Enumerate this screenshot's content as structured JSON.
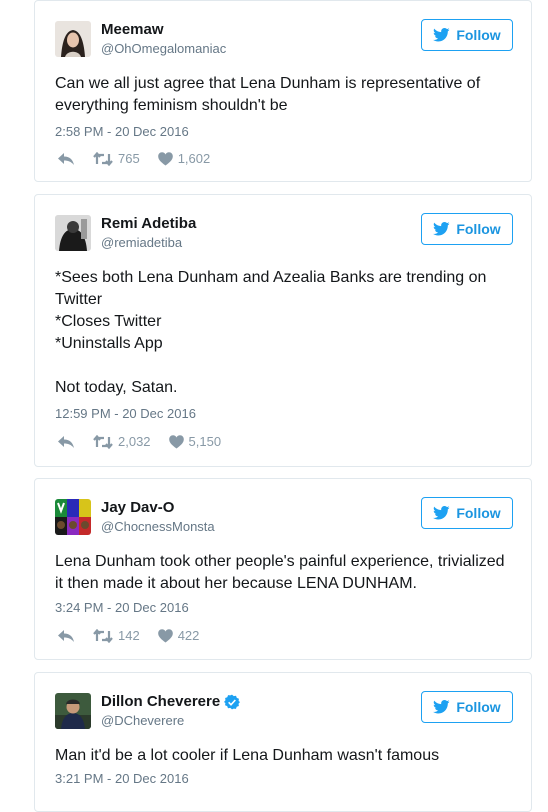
{
  "colors": {
    "twitter_blue": "#1da1f2",
    "text": "#14171a",
    "muted": "#657786",
    "action": "#8899a6"
  },
  "icons": {
    "follow": "twitter-bird-icon",
    "reply": "reply-icon",
    "retweet": "retweet-icon",
    "like": "heart-icon",
    "verified": "verified-badge-icon"
  },
  "follow_label": "Follow",
  "tweets": [
    {
      "name": "Meemaw",
      "handle": "@OhOmegalomaniac",
      "text": "Can we all just agree that Lena Dunham is representative of everything feminism shouldn't be",
      "time": "2:58 PM - 20 Dec 2016",
      "retweets": "765",
      "likes": "1,602"
    },
    {
      "name": "Remi Adetiba",
      "handle": "@remiadetiba",
      "text": "*Sees both Lena Dunham and Azealia Banks are trending on Twitter\n*Closes Twitter\n*Uninstalls App\n\nNot today, Satan.",
      "time": "12:59 PM - 20 Dec 2016",
      "retweets": "2,032",
      "likes": "5,150"
    },
    {
      "name": "Jay Dav-O",
      "handle": "@ChocnessMonsta",
      "text": "Lena Dunham took other people's painful experience, trivialized it then made it about her because LENA DUNHAM.",
      "time": "3:24 PM - 20 Dec 2016",
      "retweets": "142",
      "likes": "422"
    },
    {
      "name": "Dillon Cheverere",
      "handle": "@DCheverere",
      "verified": true,
      "text": "Man it'd be a lot cooler if Lena Dunham wasn't famous",
      "time": "3:21 PM - 20 Dec 2016"
    }
  ]
}
